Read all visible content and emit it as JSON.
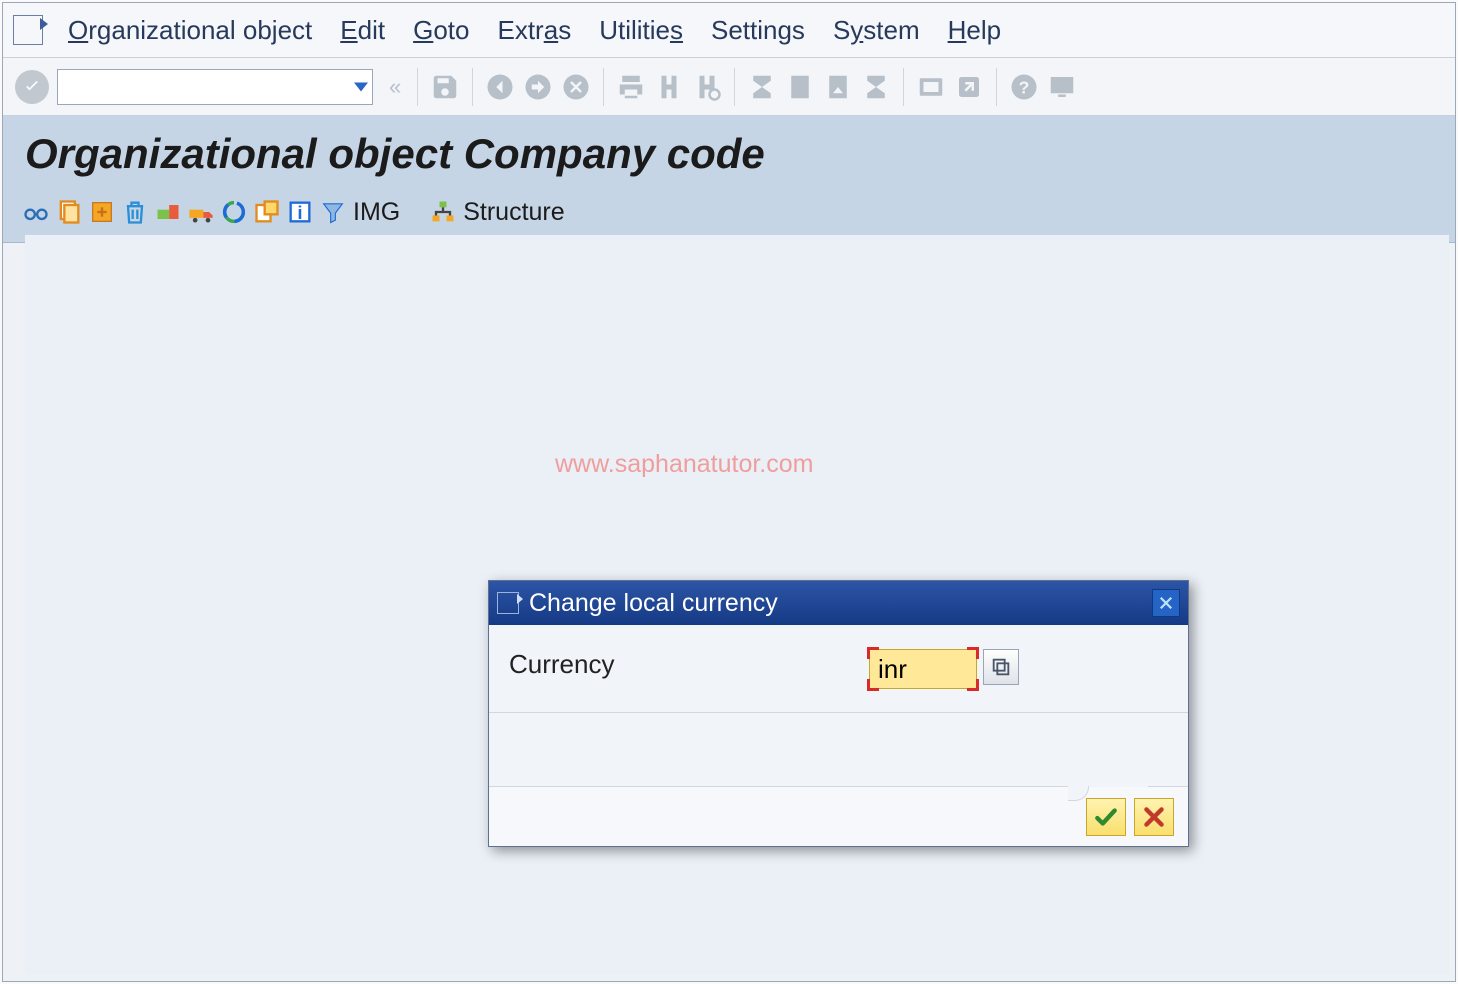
{
  "menu": {
    "items": [
      {
        "label": "Organizational object",
        "u": "O",
        "rest": "rganizational object"
      },
      {
        "label": "Edit",
        "u": "E",
        "rest": "dit"
      },
      {
        "label": "Goto",
        "u": "G",
        "rest": "oto"
      },
      {
        "label": "Extras",
        "u": "Extr",
        "post": "a",
        "rest": "s",
        "alt": true
      },
      {
        "label": "Utilities",
        "u": "Utilitie",
        "post": "s",
        "rest": ""
      },
      {
        "label": "Settings",
        "plain": "Settings"
      },
      {
        "label": "System",
        "u": "S",
        "rest": "ystem"
      },
      {
        "label": "Help",
        "u": "H",
        "rest": "elp"
      }
    ]
  },
  "toolbar": {
    "command_value": "",
    "icons": [
      "save-icon",
      "back-icon",
      "exit-icon",
      "cancel-icon",
      "print-icon",
      "find-icon",
      "find-next-icon",
      "first-page-icon",
      "prev-page-icon",
      "next-page-icon",
      "last-page-icon",
      "new-session-icon",
      "shortcut-icon",
      "help-icon",
      "layout-icon"
    ]
  },
  "page": {
    "title": "Organizational object Company code"
  },
  "app_toolbar": {
    "img_label": "IMG",
    "structure_label": "Structure",
    "icons": [
      "glasses-icon",
      "copy-icon",
      "paste-icon",
      "delete-icon",
      "transport-icon",
      "truck-icon",
      "refresh-icon",
      "activate-icon",
      "info-icon",
      "filter-icon"
    ]
  },
  "watermark": "www.saphanatutor.com",
  "dialog": {
    "title": "Change local currency",
    "field_label": "Currency",
    "field_value": "inr",
    "ok_tip": "Continue",
    "cancel_tip": "Cancel"
  }
}
